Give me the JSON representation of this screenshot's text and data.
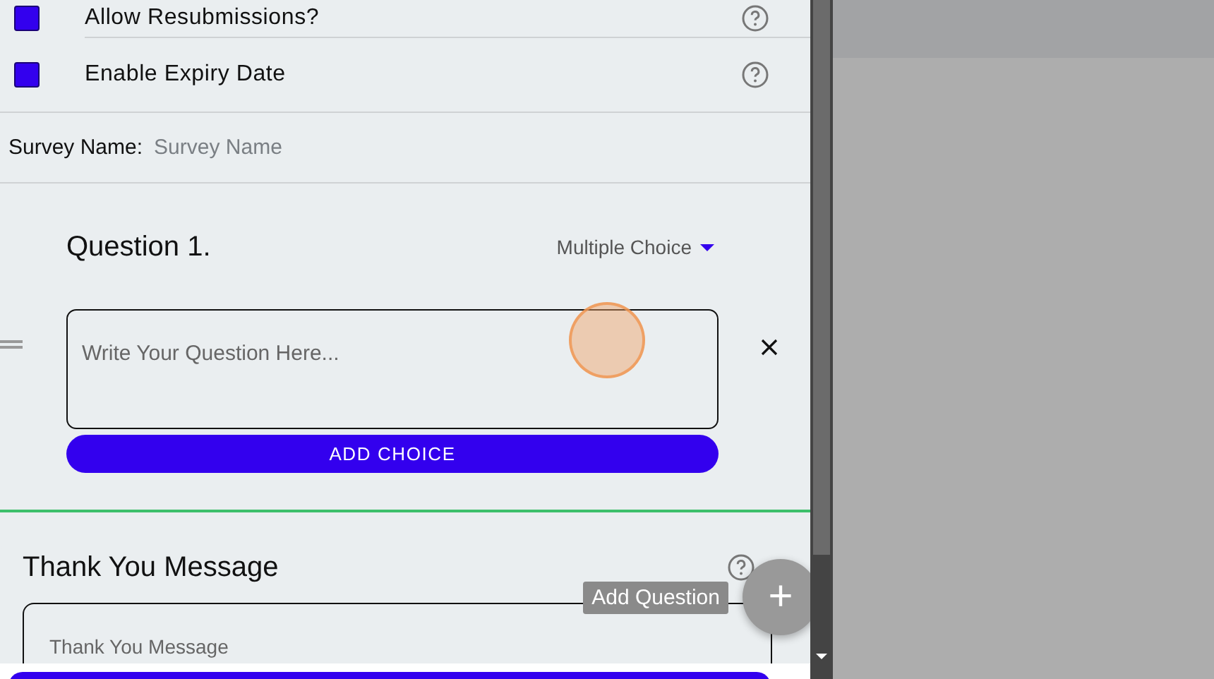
{
  "settings": [
    {
      "label": "Allow Resubmissions?",
      "checked": true
    },
    {
      "label": "Enable Expiry Date",
      "checked": true
    }
  ],
  "survey_name": {
    "label": "Survey Name:",
    "placeholder": "Survey Name"
  },
  "question": {
    "title": "Question 1.",
    "type": "Multiple Choice",
    "placeholder": "Write Your Question Here...",
    "add_choice": "ADD CHOICE"
  },
  "thank_you": {
    "title": "Thank You Message",
    "placeholder": "Thank You Message"
  },
  "fab": {
    "tooltip": "Add Question",
    "label": "+"
  }
}
